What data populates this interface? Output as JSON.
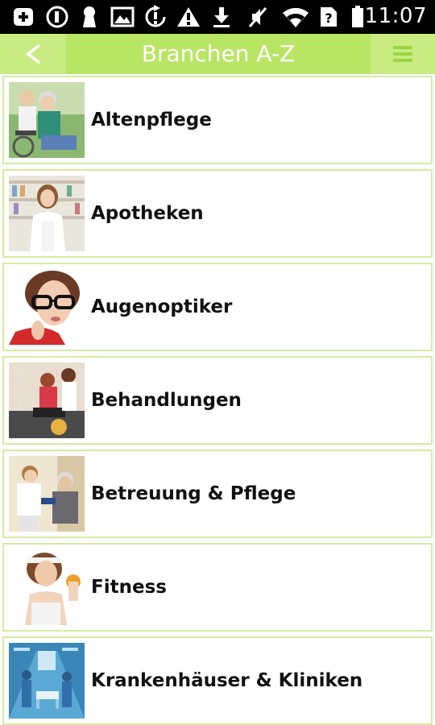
{
  "status_bar": {
    "time": "11:07",
    "icons": [
      "add-box-icon",
      "circle-one-icon",
      "keyhole-icon",
      "image-icon",
      "sync-alert-icon",
      "warning-icon",
      "download-icon",
      "mute-icon",
      "wifi-icon",
      "sim-unknown-icon",
      "battery-icon"
    ]
  },
  "header": {
    "title": "Branchen A-Z",
    "back_label": "<",
    "back_icon": "chevron-left-icon",
    "menu_icon": "menu-icon",
    "bg_color": "#c8ec82",
    "title_bg_color": "#b9e564"
  },
  "list": {
    "items": [
      {
        "label": "Altenpflege",
        "thumb": "elderly-care-photo"
      },
      {
        "label": "Apotheken",
        "thumb": "pharmacist-photo"
      },
      {
        "label": "Augenoptiker",
        "thumb": "glasses-woman-photo"
      },
      {
        "label": "Behandlungen",
        "thumb": "physiotherapy-photo"
      },
      {
        "label": "Betreuung & Pflege",
        "thumb": "nursing-photo"
      },
      {
        "label": "Fitness",
        "thumb": "fitness-woman-photo"
      },
      {
        "label": "Krankenhäuser & Kliniken",
        "thumb": "hospital-corridor-photo"
      }
    ]
  }
}
